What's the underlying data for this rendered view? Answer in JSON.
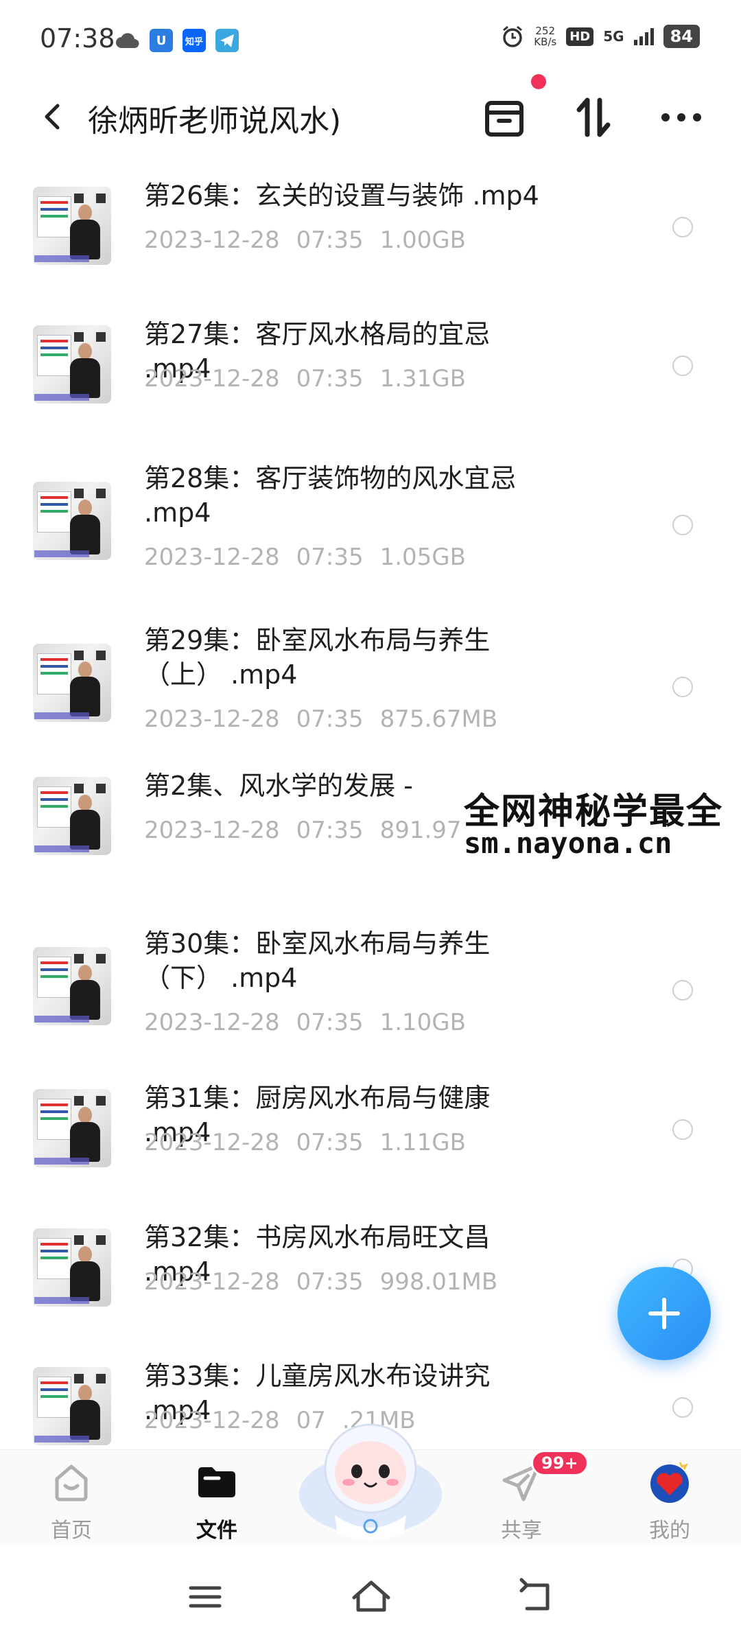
{
  "status_bar": {
    "time": "07:38",
    "net_speed_value": "252",
    "net_speed_unit": "KB/s",
    "hd": "HD",
    "network": "5G",
    "battery": "84",
    "left_icons": [
      "cloud-icon",
      "app-u-icon",
      "zhihu-icon",
      "telegram-icon"
    ],
    "zhihu_label": "知乎"
  },
  "header": {
    "title": "徐炳昕老师说风水)"
  },
  "files": [
    {
      "name": "第26集：玄关的设置与装饰 .mp4",
      "date": "2023-12-28",
      "time": "07:35",
      "size": "1.00GB"
    },
    {
      "name": "第27集：客厅风水格局的宜忌 .mp4",
      "date": "2023-12-28",
      "time": "07:35",
      "size": "1.31GB"
    },
    {
      "name": "第28集：客厅装饰物的风水宜忌 .mp4",
      "date": "2023-12-28",
      "time": "07:35",
      "size": "1.05GB"
    },
    {
      "name": "第29集：卧室风水布局与养生（上） .mp4",
      "date": "2023-12-28",
      "time": "07:35",
      "size": "875.67MB"
    },
    {
      "name": "第2集、风水学的发展 - ",
      "date": "2023-12-28",
      "time": "07:35",
      "size": "891.97"
    },
    {
      "name": "第30集：卧室风水布局与养生（下） .mp4",
      "date": "2023-12-28",
      "time": "07:35",
      "size": "1.10GB"
    },
    {
      "name": "第31集：厨房风水布局与健康 .mp4",
      "date": "2023-12-28",
      "time": "07:35",
      "size": "1.11GB"
    },
    {
      "name": "第32集：书房风水布局旺文昌 .mp4",
      "date": "2023-12-28",
      "time": "07:35",
      "size": "998.01MB"
    },
    {
      "name": "第33集：儿童房风水布设讲究 .mp4",
      "date": "2023-12-28",
      "time": "07",
      "size": ".21MB"
    }
  ],
  "watermark": {
    "line1": "全网神秘学最全",
    "line2": "sm.nayona.cn"
  },
  "bottom_nav": [
    {
      "label": "首页",
      "icon": "home-icon"
    },
    {
      "label": "文件",
      "icon": "folder-icon",
      "active": true
    },
    {
      "label": "共享",
      "icon": "send-icon",
      "badge": "99+"
    },
    {
      "label": "我的",
      "icon": "avatar-icon"
    }
  ],
  "colors": {
    "accent": "#2a8df5",
    "badge": "#f0325a",
    "meta_text": "#b3b3b3"
  }
}
